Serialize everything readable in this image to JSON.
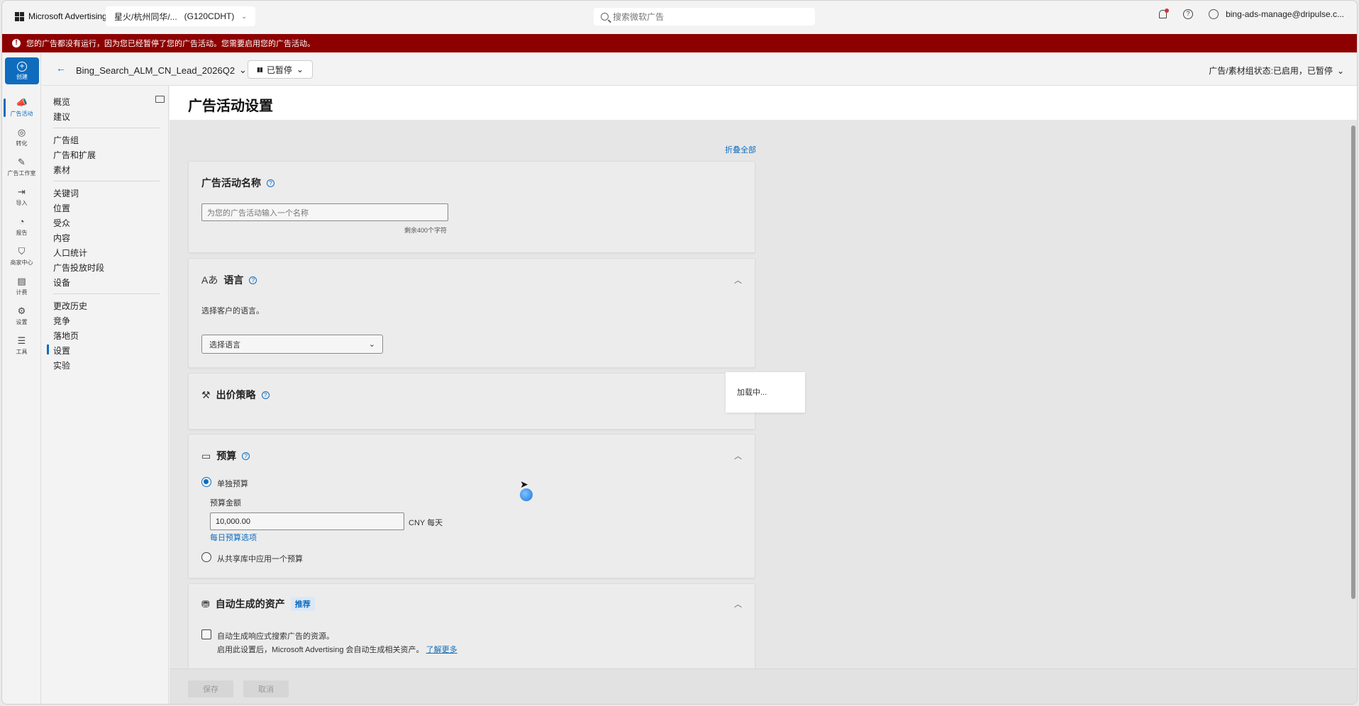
{
  "topbar": {
    "brand": "Microsoft Advertising",
    "account": "星火/杭州同华/...",
    "account_id": "(G120CDHT)",
    "search_placeholder": "搜索微软广告",
    "user_email": "bing-ads-manage@dripulse.c..."
  },
  "banner": {
    "message": "您的广告都没有运行，因为您已经暂停了您的广告活动。您需要启用您的广告活动。"
  },
  "rail": {
    "create_label": "创建",
    "items": [
      {
        "label": "广告活动",
        "icon": "megaphone-icon"
      },
      {
        "label": "转化",
        "icon": "target-icon"
      },
      {
        "label": "广告工作室",
        "icon": "studio-icon"
      },
      {
        "label": "导入",
        "icon": "import-icon"
      },
      {
        "label": "报告",
        "icon": "report-icon"
      },
      {
        "label": "商家中心",
        "icon": "shopping-bag-icon"
      },
      {
        "label": "计费",
        "icon": "billing-icon"
      },
      {
        "label": "设置",
        "icon": "gear-icon"
      },
      {
        "label": "工具",
        "icon": "tools-icon"
      }
    ]
  },
  "subnav": {
    "group1": [
      "概览",
      "建议"
    ],
    "group2": [
      "广告组",
      "广告和扩展",
      "素材"
    ],
    "group3": [
      "关键词",
      "位置",
      "受众",
      "内容",
      "人口统计",
      "广告投放时段",
      "设备"
    ],
    "group4": [
      "更改历史",
      "竞争",
      "落地页",
      "设置",
      "实验"
    ]
  },
  "campaign_bar": {
    "campaign_name": "Bing_Search_ALM_CN_Lead_2026Q2",
    "status": "已暂停",
    "right_status": "广告/素材组状态:已启用，已暂停"
  },
  "page": {
    "title": "广告活动设置",
    "collapse_all": "折叠全部"
  },
  "sections": {
    "name": {
      "title": "广告活动名称",
      "placeholder": "为您的广告活动输入一个名称",
      "remaining": "剩余400个字符"
    },
    "language": {
      "title": "语言",
      "description": "选择客户的语言。",
      "select_placeholder": "选择语言"
    },
    "bidding": {
      "title": "出价策略",
      "loading": "加载中..."
    },
    "budget": {
      "title": "预算",
      "option_individual": "单独预算",
      "amount_label": "预算金额",
      "amount_value": "10,000.00",
      "currency_unit": "CNY 每天",
      "daily_options_link": "每日预算选项",
      "option_shared": "从共享库中应用一个预算"
    },
    "auto_assets": {
      "title": "自动生成的资产",
      "badge": "推荐",
      "checkbox_label": "自动生成响应式搜索广告的资源。",
      "description": "启用此设置后，Microsoft Advertising 会自动生成相关资产。",
      "learn_more": "了解更多"
    }
  },
  "footer": {
    "save": "保存",
    "cancel": "取消"
  }
}
